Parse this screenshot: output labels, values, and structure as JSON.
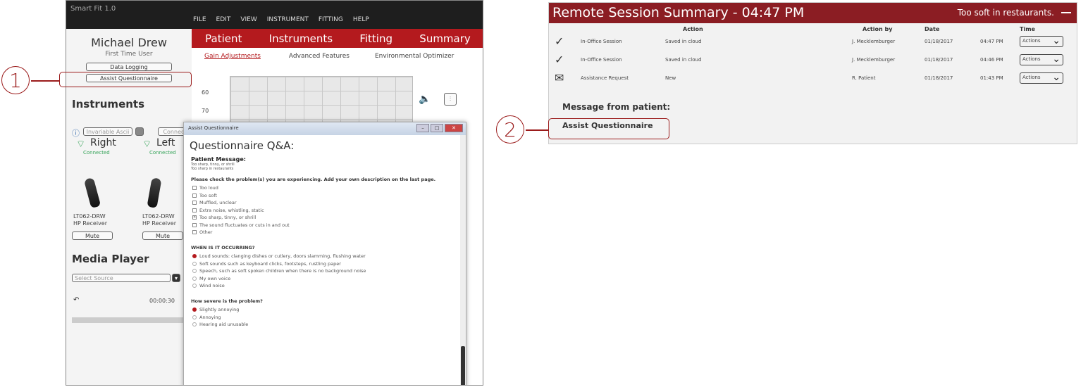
{
  "app": {
    "title": "Smart Fit 1.0",
    "menu": [
      "FILE",
      "EDIT",
      "VIEW",
      "INSTRUMENT",
      "FITTING",
      "HELP"
    ],
    "tabs": [
      "Patient",
      "Instruments",
      "Fitting",
      "Summary"
    ],
    "subtabs": [
      "Gain Adjustments",
      "Advanced Features",
      "Environmental Optimizer"
    ],
    "patient": {
      "name": "Michael Drew",
      "status": "First Time User"
    },
    "buttons": {
      "data_logging": "Data Logging",
      "assist_questionnaire": "Assist Questionnaire"
    },
    "instruments": {
      "title": "Instruments",
      "search_placeholder": "Invariable Ascii",
      "connect": "Connect",
      "right": {
        "label": "Right",
        "status": "Connected",
        "model": "LT062-DRW",
        "receiver": "HP Receiver",
        "mute": "Mute"
      },
      "left": {
        "label": "Left",
        "status": "Connected",
        "model": "LT062-DRW",
        "receiver": "HP Receiver",
        "mute": "Mute"
      }
    },
    "media": {
      "title": "Media Player",
      "select_placeholder": "Select Source",
      "time": "00:00:30"
    },
    "chart": {
      "y1": "60",
      "y2": "70"
    }
  },
  "dialog": {
    "window_title": "Assist Questionnaire",
    "heading": "Questionnaire Q&A:",
    "patient_message_label": "Patient Message:",
    "patient_message_lines": [
      "Too sharp, tinny, or shrill",
      "Too sharp in restaurants"
    ],
    "q1": "Please check the problem(s) you are experiencing. Add your own description on the last page.",
    "q1_options": [
      {
        "label": "Too loud",
        "checked": false
      },
      {
        "label": "Too soft",
        "checked": false
      },
      {
        "label": "Muffled, unclear",
        "checked": false
      },
      {
        "label": "Extra noise, whistling, static",
        "checked": false
      },
      {
        "label": "Too sharp, tinny, or shrill",
        "checked": true
      },
      {
        "label": "The sound fluctuates or cuts in and out",
        "checked": false
      },
      {
        "label": "Other",
        "checked": false
      }
    ],
    "q2": "WHEN IS IT OCCURRING?",
    "q2_options": [
      {
        "label": "Loud sounds: clanging dishes or cutlery, doors slamming, flushing water",
        "checked": true
      },
      {
        "label": "Soft sounds such as keyboard clicks, footsteps, rustling paper",
        "checked": false
      },
      {
        "label": "Speech, such as soft spoken children when there is no background noise",
        "checked": false
      },
      {
        "label": "My own voice",
        "checked": false
      },
      {
        "label": "Wind noise",
        "checked": false
      }
    ],
    "q3": "How severe is the problem?",
    "q3_options": [
      {
        "label": "Slightly annoying",
        "checked": true
      },
      {
        "label": "Annoying",
        "checked": false
      },
      {
        "label": "Hearing aid unusable",
        "checked": false
      }
    ]
  },
  "panel": {
    "title": "Remote Session Summary - 04:47 PM",
    "note": "Too soft in restaurants.",
    "columns": {
      "action": "Action",
      "action_by": "Action by",
      "date": "Date",
      "time": "Time"
    },
    "rows": [
      {
        "icon": "check-circle-icon",
        "type": "In-Office Session",
        "status": "Saved in cloud",
        "by": "J. Mecklemburger",
        "date": "01/18/2017",
        "time": "04:47 PM",
        "button": "Actions"
      },
      {
        "icon": "check-circle-icon",
        "type": "In-Office Session",
        "status": "Saved in cloud",
        "by": "J. Mecklemburger",
        "date": "01/18/2017",
        "time": "04:46 PM",
        "button": "Actions"
      },
      {
        "icon": "envelope-icon",
        "type": "Assistance Request",
        "status": "New",
        "by": "R. Patient",
        "date": "01/18/2017",
        "time": "01:43 PM",
        "button": "Actions"
      }
    ],
    "message_heading": "Message from patient:",
    "message_item": "Assist Questionnaire"
  },
  "callouts": [
    "1",
    "2"
  ]
}
